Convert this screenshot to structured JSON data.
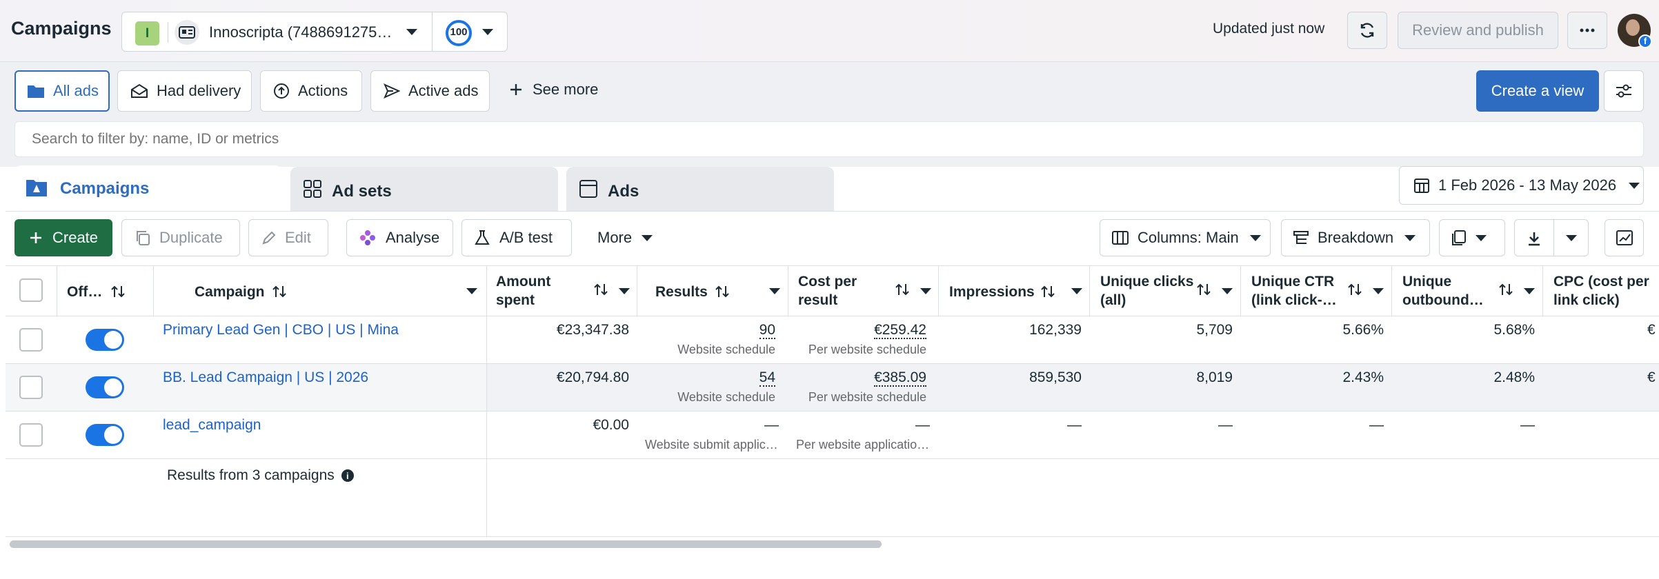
{
  "header": {
    "title": "Campaigns",
    "account_initial": "I",
    "account_name": "Innoscripta (7488691275…",
    "score": "100",
    "updated": "Updated just now",
    "review_publish": "Review and publish"
  },
  "views": {
    "tabs": [
      "All ads",
      "Had delivery",
      "Actions",
      "Active ads"
    ],
    "see_more": "See more",
    "create_view": "Create a view"
  },
  "search": {
    "placeholder": "Search to filter by: name, ID or metrics"
  },
  "level_tabs": {
    "campaigns": "Campaigns",
    "ad_sets": "Ad sets",
    "ads": "Ads"
  },
  "date_range": "1 Feb 2026 - 13 May 2026",
  "toolbar": {
    "create": "Create",
    "duplicate": "Duplicate",
    "edit": "Edit",
    "analyse": "Analyse",
    "ab_test": "A/B test",
    "more": "More",
    "columns": "Columns: Main",
    "breakdown": "Breakdown"
  },
  "table": {
    "headers": {
      "off": "Off…",
      "campaign": "Campaign",
      "amount_1": "Amount",
      "amount_2": "spent",
      "results": "Results",
      "cpr_1": "Cost per",
      "cpr_2": "result",
      "impressions": "Impressions",
      "uclicks_1": "Unique clicks",
      "uclicks_2": "(all)",
      "uctr_1": "Unique CTR",
      "uctr_2": "(link click-…",
      "uout_1": "Unique",
      "uout_2": "outbound…",
      "cpc_1": "CPC (cost per",
      "cpc_2": "link click)"
    },
    "rows": [
      {
        "name": "Primary Lead Gen | CBO | US | Mina",
        "amount": "€23,347.38",
        "results": "90",
        "results_sub": "Website schedule",
        "cpr": "€259.42",
        "cpr_sub": "Per website schedule",
        "impressions": "162,339",
        "unique_clicks": "5,709",
        "unique_ctr": "5.66%",
        "unique_outbound": "5.68%",
        "cpc": "€"
      },
      {
        "name": "BB. Lead Campaign | US | 2026",
        "amount": "€20,794.80",
        "results": "54",
        "results_sub": "Website schedule",
        "cpr": "€385.09",
        "cpr_sub": "Per website schedule",
        "impressions": "859,530",
        "unique_clicks": "8,019",
        "unique_ctr": "2.43%",
        "unique_outbound": "2.48%",
        "cpc": "€"
      },
      {
        "name": "lead_campaign",
        "amount": "€0.00",
        "results": "—",
        "results_sub": "Website submit applic…",
        "cpr": "—",
        "cpr_sub": "Per website applicatio…",
        "impressions": "—",
        "unique_clicks": "—",
        "unique_ctr": "—",
        "unique_outbound": "—",
        "cpc": ""
      }
    ],
    "summary": "Results from 3 campaigns"
  },
  "colors": {
    "accent": "#1b74e4",
    "create_green": "#1f6e43",
    "link": "#1d62c7",
    "primary_blue": "#2e6cc2"
  }
}
